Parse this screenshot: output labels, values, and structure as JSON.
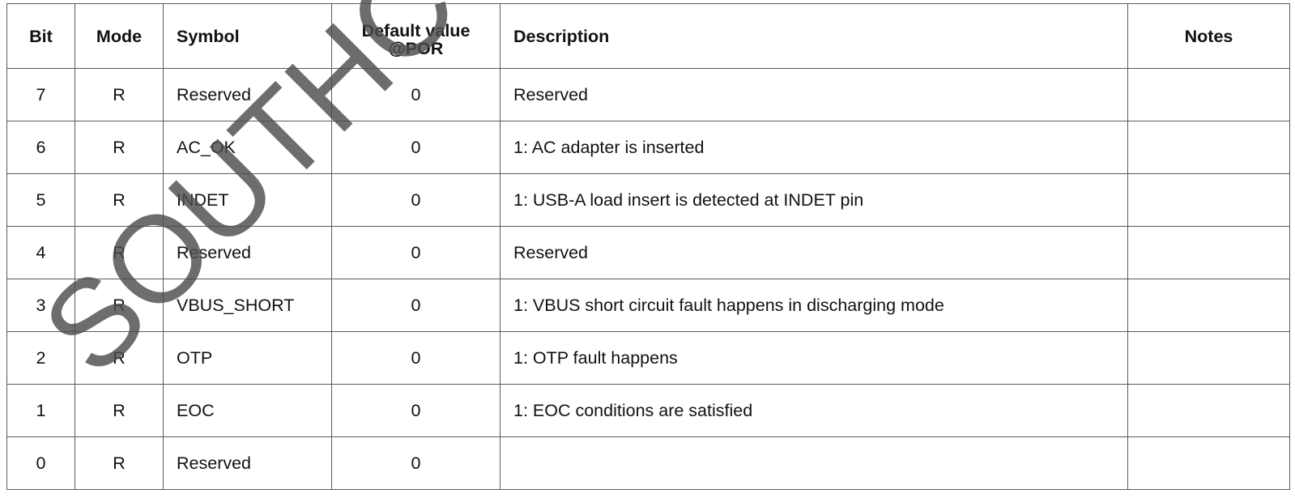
{
  "table": {
    "headers": {
      "bit": "Bit",
      "mode": "Mode",
      "symbol": "Symbol",
      "default_line1": "Default value",
      "default_line2": "@POR",
      "description": "Description",
      "notes": "Notes"
    },
    "rows": [
      {
        "bit": "7",
        "mode": "R",
        "symbol": "Reserved",
        "default": "0",
        "description": "Reserved",
        "notes": ""
      },
      {
        "bit": "6",
        "mode": "R",
        "symbol": "AC_OK",
        "default": "0",
        "description": "1: AC adapter is inserted",
        "notes": ""
      },
      {
        "bit": "5",
        "mode": "R",
        "symbol": "INDET",
        "default": "0",
        "description": "1: USB-A load insert is detected at INDET pin",
        "notes": ""
      },
      {
        "bit": "4",
        "mode": "R",
        "symbol": "Reserved",
        "default": "0",
        "description": "Reserved",
        "notes": ""
      },
      {
        "bit": "3",
        "mode": "R",
        "symbol": "VBUS_SHORT",
        "default": "0",
        "description": "1: VBUS short circuit fault happens in discharging mode",
        "notes": ""
      },
      {
        "bit": "2",
        "mode": "R",
        "symbol": "OTP",
        "default": "0",
        "description": "1: OTP fault happens",
        "notes": ""
      },
      {
        "bit": "1",
        "mode": "R",
        "symbol": "EOC",
        "default": "0",
        "description": "1: EOC conditions are satisfied",
        "notes": ""
      },
      {
        "bit": "0",
        "mode": "R",
        "symbol": "Reserved",
        "default": "0",
        "description": "",
        "notes": ""
      }
    ]
  },
  "watermark": {
    "text": "SOUTHC",
    "color": "#4d4d4d"
  }
}
